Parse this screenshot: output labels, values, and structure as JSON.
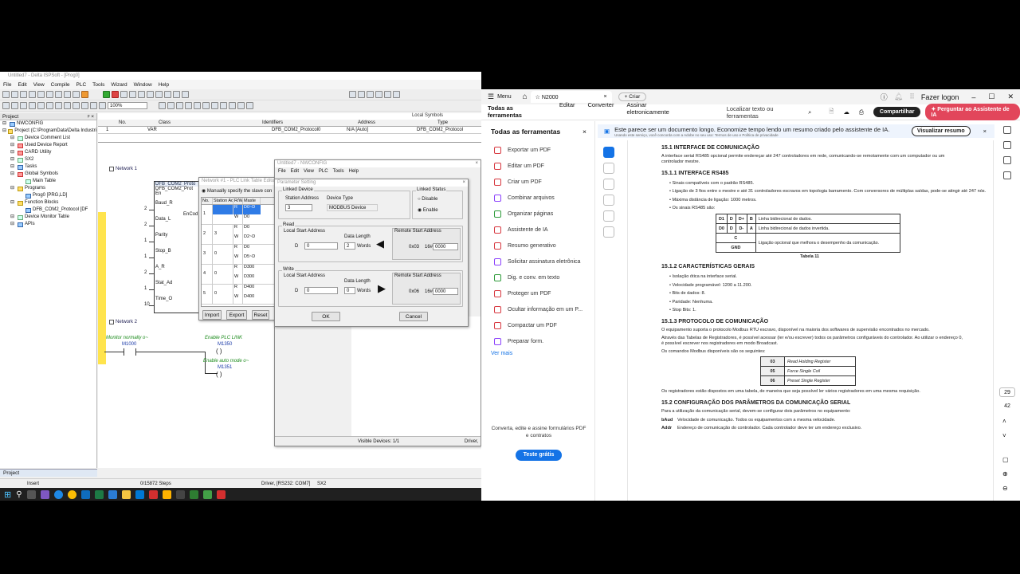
{
  "left_app": {
    "title": "Untitled7 - Delta ISPSoft - [Prog0]",
    "menu": [
      "File",
      "Edit",
      "View",
      "Compile",
      "PLC",
      "Tools",
      "Wizard",
      "Window",
      "Help"
    ],
    "zoom": "100%",
    "project_panel": {
      "title": "Project",
      "tree": [
        {
          "label": "NWCONFIG",
          "level": 0,
          "icon": "network-icon"
        },
        {
          "label": "Project (C:\\ProgramData\\Delta Industri",
          "level": 0,
          "icon": "folder-icon"
        },
        {
          "label": "Device Comment List",
          "level": 1,
          "icon": "list-icon"
        },
        {
          "label": "Used Device Report",
          "level": 1,
          "icon": "report-icon"
        },
        {
          "label": "CARD Utility",
          "level": 1,
          "icon": "card-icon"
        },
        {
          "label": "SX2",
          "level": 1,
          "icon": "plc-icon"
        },
        {
          "label": "Tasks",
          "level": 1,
          "icon": "tasks-icon"
        },
        {
          "label": "Global Symbols",
          "level": 1,
          "icon": "symbols-icon"
        },
        {
          "label": "Main Table",
          "level": 2,
          "icon": "table-icon"
        },
        {
          "label": "Programs",
          "level": 1,
          "icon": "folder-icon"
        },
        {
          "label": "Prog0 [PRG,LD]",
          "level": 2,
          "icon": "program-icon"
        },
        {
          "label": "Function Blocks",
          "level": 1,
          "icon": "folder-icon"
        },
        {
          "label": "DFB_COM2_Protocol [DF",
          "level": 2,
          "icon": "function-block-icon"
        },
        {
          "label": "Device Monitor Table",
          "level": 1,
          "icon": "monitor-icon"
        },
        {
          "label": "APIs",
          "level": 1,
          "icon": "api-icon"
        }
      ],
      "tab": "Project"
    },
    "var_table": {
      "header_right": "Local Symbols",
      "columns": [
        "No.",
        "Class",
        "Identifiers",
        "Address",
        "Type"
      ],
      "rows": [
        [
          "1",
          "VAR",
          "DFB_COM2_Protocol0",
          "N/A [Auto]",
          "DFB_COM2_Protocol"
        ]
      ]
    },
    "ladder": {
      "network1": "Network 1",
      "network2": "Network 2",
      "fb_name": "DFB_COM2_Proto",
      "fb_type": "DFB_COM2_Prot",
      "pins": [
        "En",
        "Baud_R",
        "Data_L",
        "Parity",
        "Stop_B",
        "A_R",
        "Stat_Ad",
        "Time_O"
      ],
      "pin_numbers": [
        "2",
        "2",
        "1",
        "1",
        "2",
        "1",
        "10"
      ],
      "right_pin": "EnCod",
      "rung2": {
        "c1_comment": "Monitor normally o~",
        "c1_addr": "M1000",
        "c2_comment": "Enable PLC LINK",
        "c2_addr": "M1350",
        "c3_comment": "Enable auto mode o~",
        "c3_addr": "M1351"
      }
    },
    "plc_link_dialog": {
      "title": "Network #1 - PLC Link Table Editor",
      "radio": "Manually specify the slave con",
      "columns": [
        "No.",
        "Station Addr",
        "R/W",
        "Maste"
      ],
      "rows": [
        {
          "no": "1",
          "addr": "",
          "rw": [
            "R",
            "W"
          ],
          "m": [
            "D0~D",
            "D0"
          ]
        },
        {
          "no": "2",
          "addr": "3",
          "rw": [
            "R",
            "W"
          ],
          "m": [
            "D0",
            "D2~D"
          ]
        },
        {
          "no": "3",
          "addr": "0",
          "rw": [
            "R",
            "W"
          ],
          "m": [
            "D0",
            "D5~D"
          ]
        },
        {
          "no": "4",
          "addr": "0",
          "rw": [
            "R",
            "W"
          ],
          "m": [
            "D300",
            "D300"
          ]
        },
        {
          "no": "5",
          "addr": "0",
          "rw": [
            "R",
            "W"
          ],
          "m": [
            "D400",
            "D400"
          ]
        }
      ],
      "buttons": [
        "Import",
        "Export",
        "Reset"
      ]
    },
    "nwconfig": {
      "title": "Untitled7 - NWCONFIG",
      "menu": [
        "File",
        "Edit",
        "View",
        "PLC",
        "Tools",
        "Help"
      ],
      "status": "Visible Devices: 1/1",
      "driver": "Driver,"
    },
    "param_dialog": {
      "title": "Parameter Setting",
      "linked_device": "Linked Device",
      "station_address_label": "Station Address",
      "station_address": "3",
      "device_type_label": "Device Type",
      "device_type": "MODBUS Device",
      "linked_status": "Linked Status",
      "disable": "Disable",
      "enable": "Enable",
      "read": "Read",
      "write": "Write",
      "local_start": "Local Start Address",
      "data_length": "Data Length",
      "words": "Words",
      "d": "D",
      "remote_start": "Remote Start Address",
      "read_local": "0",
      "read_len": "2",
      "read_fc": "0x03",
      "read_16": "16#",
      "read_remote": "0000",
      "write_local": "0",
      "write_len": "0",
      "write_fc": "0x06",
      "write_16": "16#",
      "write_remote": "0000",
      "ok": "OK",
      "cancel": "Cancel"
    },
    "status_bar": {
      "mode": "Insert",
      "steps": "0/15872 Steps",
      "driver": "Driver, [RS232: COM7]",
      "plc": "SX2"
    }
  },
  "acrobat": {
    "menu_label": "Menu",
    "tab_title": "N2000",
    "new_tab": "+ Criar",
    "login": "Fazer logon",
    "nav": [
      "Todas as ferramentas",
      "Editar",
      "Converter",
      "Assinar eletronicamente"
    ],
    "search_placeholder": "Localizar texto ou ferramentas",
    "share": "Compartilhar",
    "ai_button": "Perguntar ao Assistente de IA",
    "tools_title": "Todas as ferramentas",
    "tools": [
      {
        "label": "Exportar um PDF",
        "color": "#d7373f"
      },
      {
        "label": "Editar um PDF",
        "color": "#d7373f"
      },
      {
        "label": "Criar um PDF",
        "color": "#d7373f"
      },
      {
        "label": "Combinar arquivos",
        "color": "#8a3ffc"
      },
      {
        "label": "Organizar páginas",
        "color": "#2e9b3a"
      },
      {
        "label": "Assistente de IA",
        "color": "#d7373f"
      },
      {
        "label": "Resumo generativo",
        "color": "#d7373f"
      },
      {
        "label": "Solicitar assinatura eletrônica",
        "color": "#8a3ffc"
      },
      {
        "label": "Dig. e conv. em texto",
        "color": "#2e9b3a"
      },
      {
        "label": "Proteger um PDF",
        "color": "#d7373f"
      },
      {
        "label": "Ocultar informação em um P...",
        "color": "#d7373f"
      },
      {
        "label": "Compactar um PDF",
        "color": "#d7373f"
      },
      {
        "label": "Preparar form.",
        "color": "#8a3ffc"
      }
    ],
    "see_more": "Ver mais",
    "promo": "Converta, edite e assine formulários PDF e contratos",
    "trial": "Teste grátis",
    "banner": "Este parece ser um documento longo. Economize tempo lendo um resumo criado pelo assistente de IA.",
    "banner_sub": "Usando este serviço, você concorda com a Adobe no seu uso: Termos de uso e Política de privacidade",
    "banner_btn": "Visualizar resumo",
    "page_num": "29",
    "page_total": "42",
    "doc": {
      "h1": "15.1    INTERFACE DE COMUNICAÇÃO",
      "p1": "A interface serial RS485 opcional permite endereçar até 247 controladores em rede, comunicando-se remotamente com um computador ou um controlador mestre.",
      "h2": "15.1.1    INTERFACE RS485",
      "list1": [
        "Sinais compatíveis com o padrão RS485.",
        "Ligação de 3 fios entre o mestre e até 31 controladores escravos em topologia barramento. Com conversores de múltiplas saídas, pode-se atingir até 247 nós.",
        "Máxima distância de ligação: 1000 metros.",
        "Os sinais RS485 são:"
      ],
      "sig_table": [
        {
          "c": [
            "D1",
            "D",
            "D+",
            "B"
          ],
          "d": "Linha bidirecional de dados."
        },
        {
          "c": [
            "D0",
            "D",
            "D-",
            "A"
          ],
          "d": "Linha bidirecional de dados invertida."
        },
        {
          "c": [
            "C"
          ],
          "d": "Ligação opcional que melhora o desempenho da comunicação."
        },
        {
          "c": [
            "GND"
          ],
          "d": ""
        }
      ],
      "table_caption": "Tabela 11",
      "h3": "15.1.2    CARACTERÍSTICAS GERAIS",
      "list2": [
        "Isolação ótica na interface serial.",
        "Velocidade programável: 1200 a 11.200.",
        "Bits de dados: 8.",
        "Paridade: Nenhuma.",
        "Stop Bits: 1."
      ],
      "h4": "15.1.3    PROTOCOLO DE COMUNICAÇÃO",
      "p2": "O equipamento suporta o protocolo Modbus RTU escravo, disponível na maioria dos softwares de supervisão encontrados no mercado.",
      "p3": "Através das Tabelas de Registradores, é possível acessar (ler e/ou escrever) todos os parâmetros configuráveis do controlador. Ao utilizar o endereço 0, é possível escrever nos registradores em modo Broadcast.",
      "p4": "Os comandos Modbus disponíveis são os seguintes:",
      "cmd_table": [
        [
          "03",
          "Read Holding Register"
        ],
        [
          "05",
          "Force Single Coil"
        ],
        [
          "06",
          "Preset Single Register"
        ]
      ],
      "p5": "Os registradores estão dispostos em uma tabela, de maneira que seja possível ler vários registradores em uma mesma requisição.",
      "h5": "15.2    CONFIGURAÇÃO DOS PARÂMETROS DA COMUNICAÇÃO SERIAL",
      "p6": "Para a utilização da comunicação serial, devem-se configurar dois parâmetros no equipamento:",
      "defs": [
        [
          "bAud",
          "Velocidade de comunicação. Todos os equipamentos com a mesma velocidade."
        ],
        [
          "Addr",
          "Endereço de comunicação do controlador. Cada controlador deve ter um endereço exclusivo."
        ]
      ]
    }
  }
}
